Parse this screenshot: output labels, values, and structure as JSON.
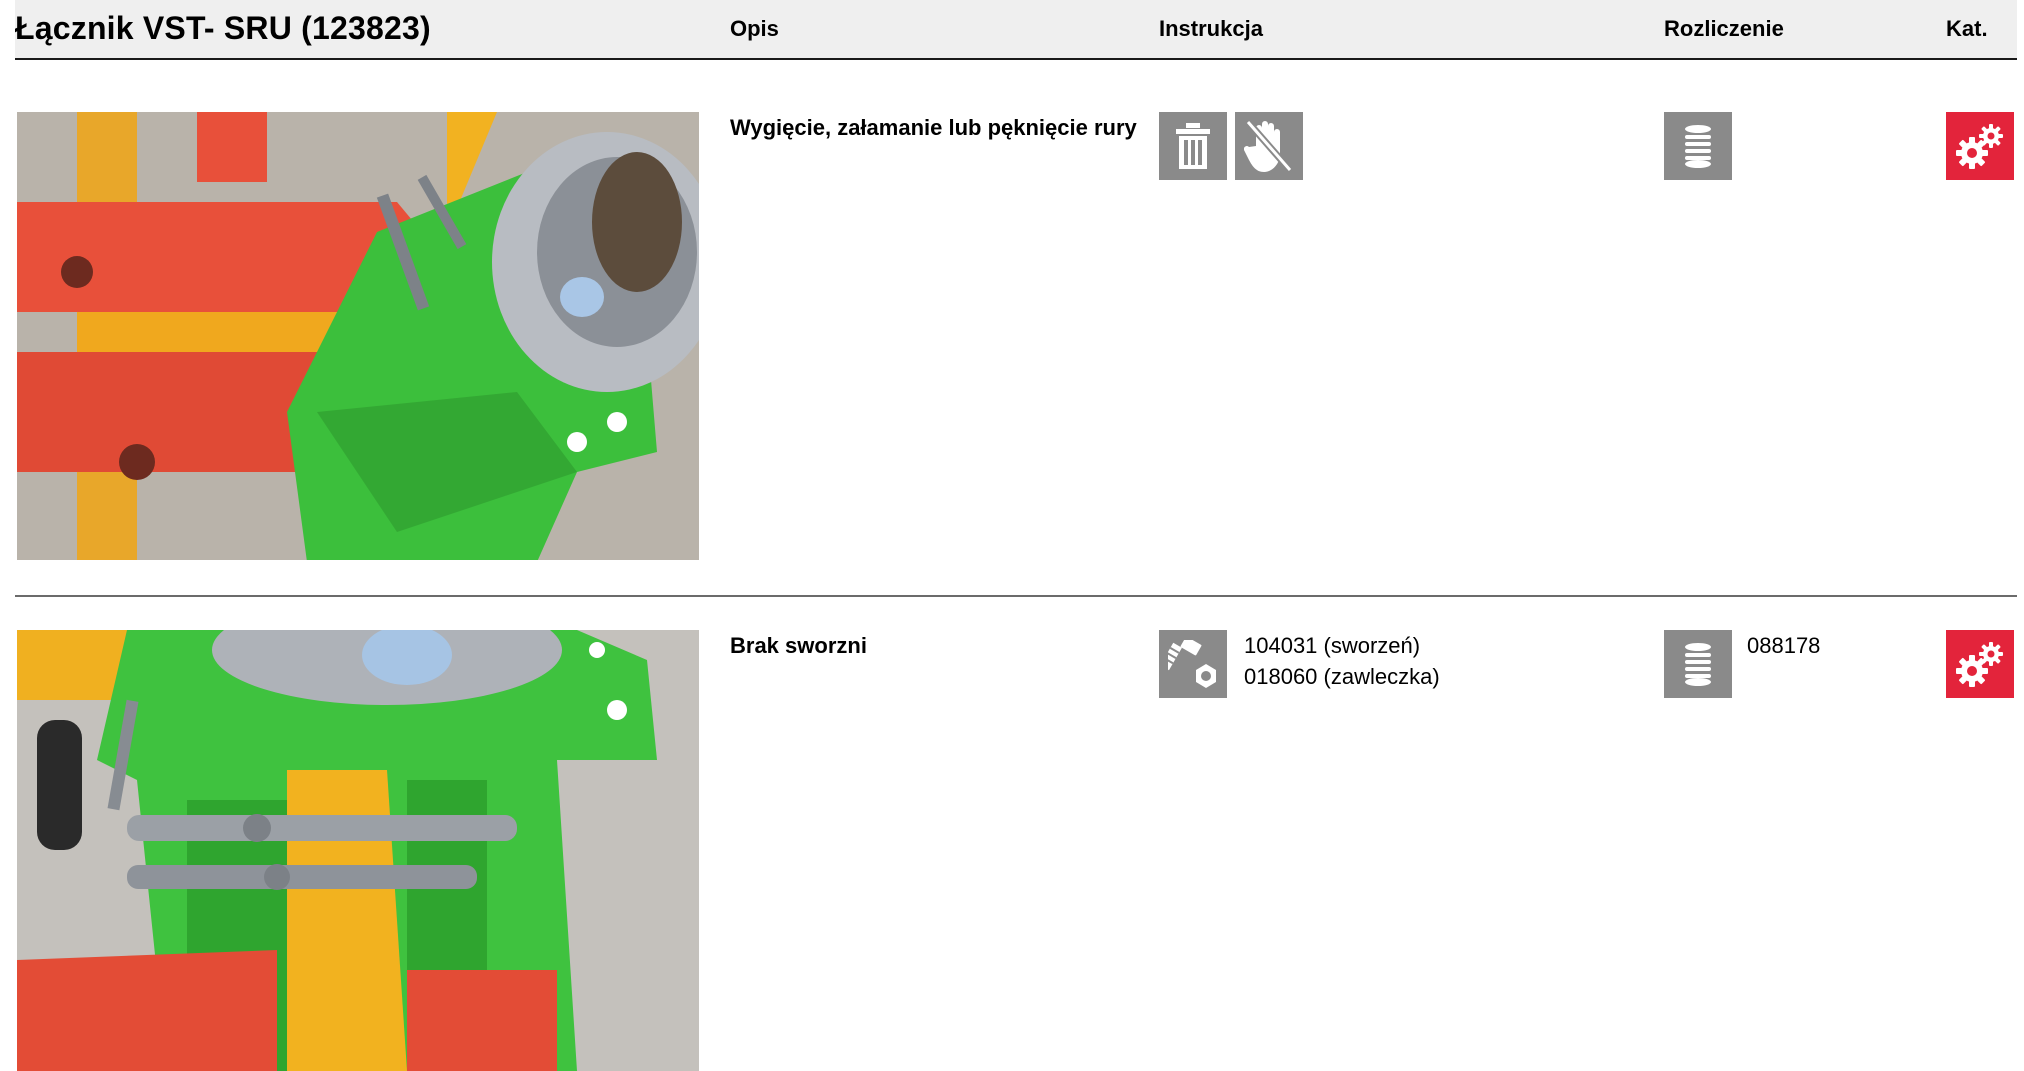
{
  "header": {
    "title": "Łącznik VST- SRU (123823)",
    "col_opis": "Opis",
    "col_instrukcja": "Instrukcja",
    "col_rozliczenie": "Rozliczenie",
    "col_kat": "Kat."
  },
  "rows": [
    {
      "description": "Wygięcie, załamanie lub pęknięcie rury",
      "instruction_icons": [
        "trash-icon",
        "no-hand-icon"
      ],
      "instruction_parts": [],
      "settlement_icon": "stack-icon",
      "settlement_code": "",
      "category_icon": "gears-icon"
    },
    {
      "description": "Brak sworzni",
      "instruction_icons": [
        "bolt-nut-icon"
      ],
      "instruction_parts": [
        "104031 (sworzeń)",
        "018060 (zawleczka)"
      ],
      "settlement_icon": "stack-icon",
      "settlement_code": "088178",
      "category_icon": "gears-icon"
    }
  ],
  "colors": {
    "icon_gray": "#8a8a8a",
    "category_red": "#e3243b",
    "header_bg": "#efefef"
  }
}
